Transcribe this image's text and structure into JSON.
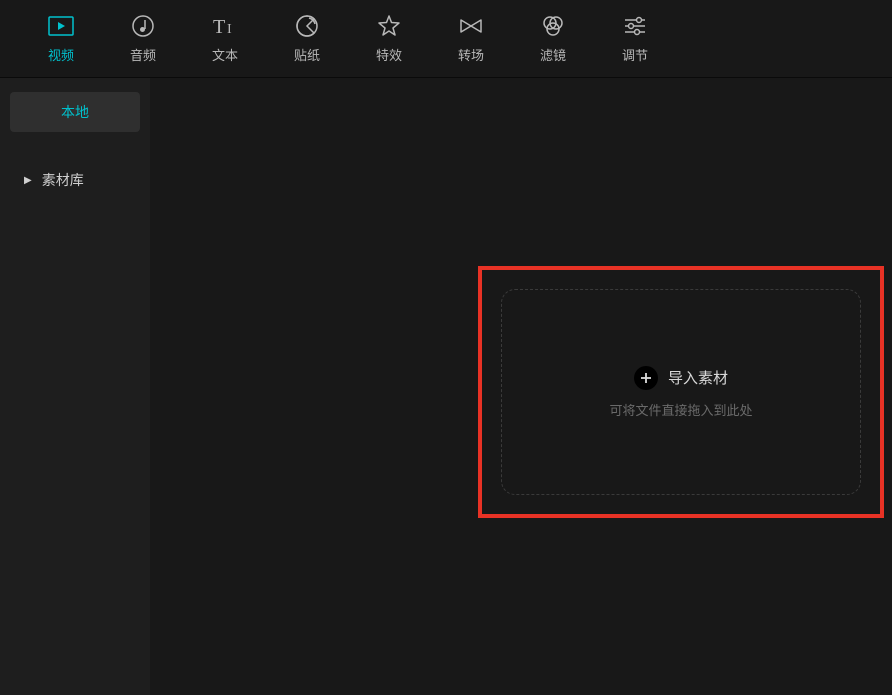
{
  "toolbar": {
    "items": [
      {
        "id": "video",
        "label": "视频",
        "active": true
      },
      {
        "id": "audio",
        "label": "音频"
      },
      {
        "id": "text",
        "label": "文本"
      },
      {
        "id": "sticker",
        "label": "贴纸"
      },
      {
        "id": "effect",
        "label": "特效"
      },
      {
        "id": "transition",
        "label": "转场"
      },
      {
        "id": "filter",
        "label": "滤镜"
      },
      {
        "id": "adjust",
        "label": "调节"
      }
    ]
  },
  "sidebar": {
    "local_label": "本地",
    "library_label": "素材库"
  },
  "dropzone": {
    "title": "导入素材",
    "subtitle": "可将文件直接拖入到此处"
  },
  "colors": {
    "accent": "#00c1cd",
    "highlight": "#e83225",
    "bg": "#181818"
  }
}
